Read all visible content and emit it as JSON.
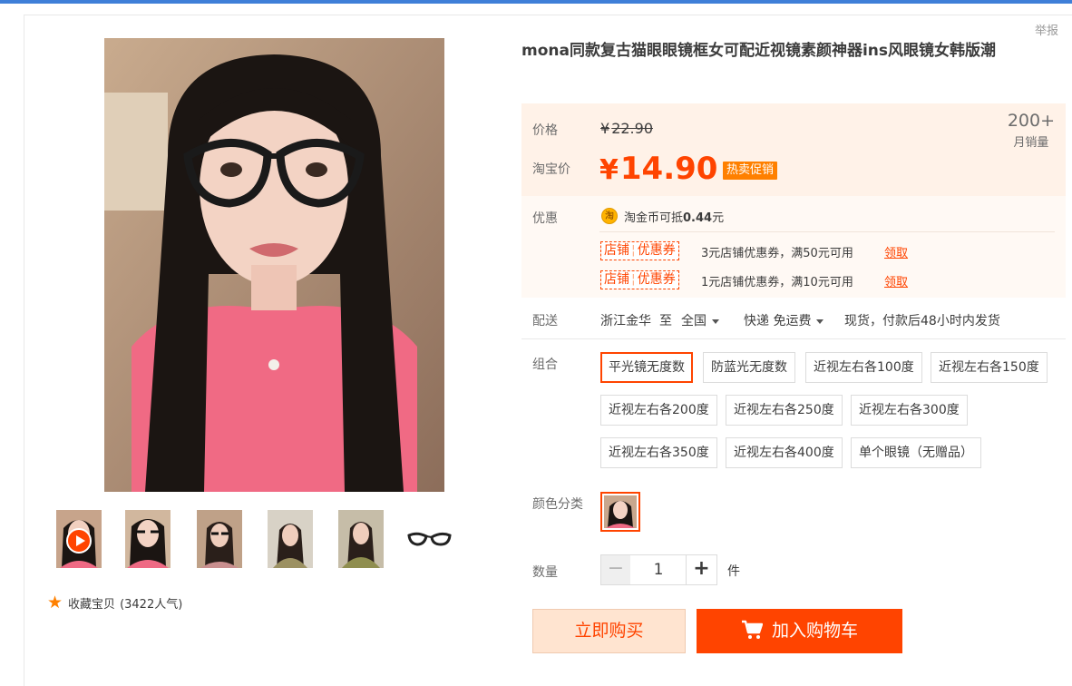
{
  "header": {
    "report_label": "举报"
  },
  "product": {
    "title": "mona同款复古猫眼眼镜框女可配近视镜素颜神器ins风眼镜女韩版潮"
  },
  "price": {
    "label": "价格",
    "currency": "¥",
    "original": "22.90",
    "taobao_label": "淘宝价",
    "current": "14.90",
    "promo_tag": "热卖促销",
    "sales_count": "200+",
    "sales_label": "月销量"
  },
  "promo": {
    "label": "优惠",
    "coin_icon_text": "淘",
    "coin_text": "淘金币可抵",
    "coin_amount": "0.44",
    "coin_unit": "元",
    "coupons": [
      {
        "tag_left": "店铺",
        "tag_right": "优惠券",
        "desc": "3元店铺优惠券，满50元可用",
        "claim": "领取"
      },
      {
        "tag_left": "店铺",
        "tag_right": "优惠券",
        "desc": "1元店铺优惠券，满10元可用",
        "claim": "领取"
      }
    ]
  },
  "shipping": {
    "label": "配送",
    "from": "浙江金华",
    "to_word": "至",
    "destination": "全国",
    "method": "快递 免运费",
    "note": "现货，付款后48小时内发货"
  },
  "combo": {
    "label": "组合",
    "options": [
      "平光镜无度数",
      "防蓝光无度数",
      "近视左右各100度",
      "近视左右各150度",
      "近视左右各200度",
      "近视左右各250度",
      "近视左右各300度",
      "近视左右各350度",
      "近视左右各400度",
      "单个眼镜（无赠品）"
    ]
  },
  "color": {
    "label": "颜色分类"
  },
  "quantity": {
    "label": "数量",
    "minus": "−",
    "value": "1",
    "plus": "+",
    "unit": "件"
  },
  "actions": {
    "buy_now": "立即购买",
    "add_cart": "加入购物车"
  },
  "favorite": {
    "star": "★",
    "text": "收藏宝贝",
    "count": "(3422人气)"
  },
  "colors": {
    "accent": "#ff4400",
    "price_bg": "#fff2e8",
    "hot_tag": "#ff8000",
    "top_bar": "#3f7fd8"
  },
  "icons": {
    "report": "report-link",
    "play": "play-icon",
    "star": "star-icon",
    "coin": "taobao-coin-icon",
    "cart": "cart-icon",
    "caret": "chevron-down-icon"
  }
}
